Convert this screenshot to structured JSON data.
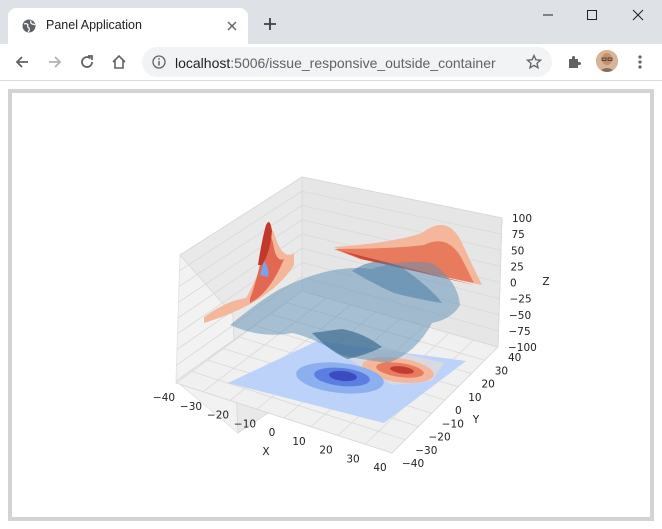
{
  "browser": {
    "tab": {
      "title": "Panel Application",
      "favicon": "globe-icon"
    },
    "address_bar": {
      "host": "localhost",
      "path": ":5006/issue_responsive_outside_container"
    },
    "toolbar_icons": [
      "back-icon",
      "forward-icon",
      "reload-icon",
      "home-icon",
      "info-icon",
      "star-icon",
      "extensions-icon",
      "avatar",
      "menu-icon"
    ],
    "window_controls": [
      "minimize-icon",
      "maximize-icon",
      "close-icon"
    ]
  },
  "chart_data": {
    "type": "surface3d",
    "title": "",
    "xlabel": "X",
    "ylabel": "Y",
    "zlabel": "Z",
    "xlim": [
      -40,
      40
    ],
    "ylim": [
      -40,
      40
    ],
    "zlim": [
      -100,
      100
    ],
    "x_ticks": [
      "−40",
      "−30",
      "−20",
      "−10",
      "0",
      "10",
      "20",
      "30",
      "40"
    ],
    "y_ticks": [
      "−40",
      "−30",
      "−20",
      "−10",
      "0",
      "10",
      "20",
      "30",
      "40"
    ],
    "z_ticks": [
      "−100",
      "−75",
      "−50",
      "−25",
      "0",
      "25",
      "50",
      "75",
      "100"
    ],
    "grid": true,
    "colormap": "coolwarm",
    "colors": {
      "surface": "#5b8db5",
      "warm": "#d6463a",
      "cool": "#3b4cc0",
      "light_cool": "#b9d0f9",
      "light_warm": "#f4b79b"
    }
  }
}
